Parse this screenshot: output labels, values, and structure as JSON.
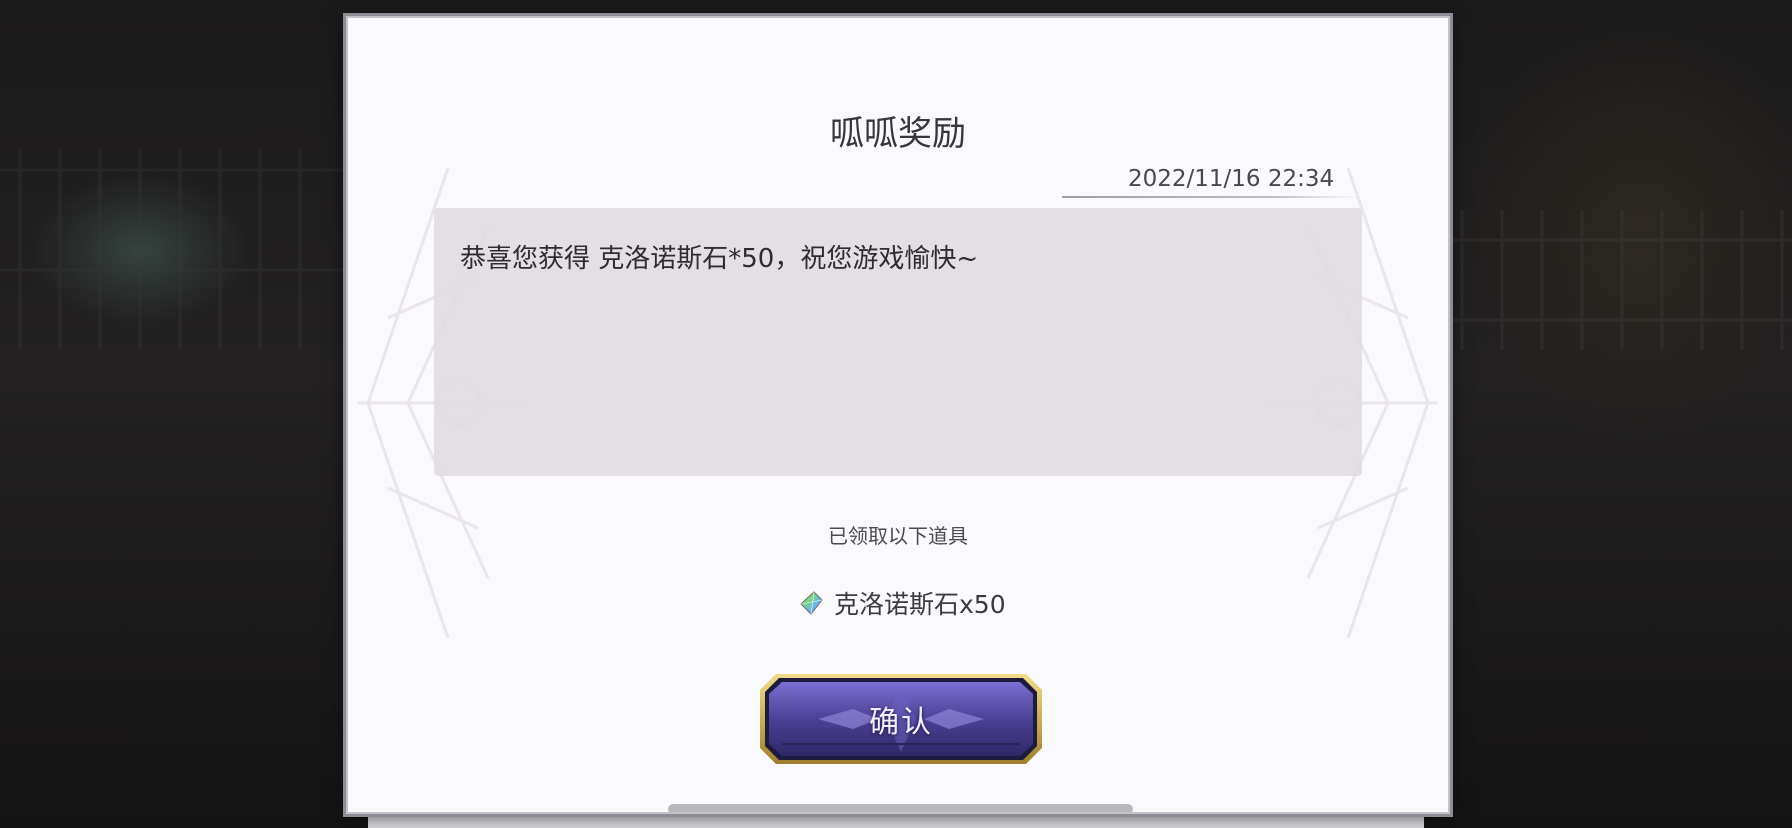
{
  "dialog": {
    "title": "呱呱奖励",
    "timestamp": "2022/11/16 22:34",
    "message": "恭喜您获得 克洛诺斯石*50，祝您游戏愉快~",
    "received_label": "已领取以下道具",
    "items": [
      {
        "icon": "chronos-stone-icon",
        "label": "克洛诺斯石x50"
      }
    ],
    "confirm_label": "确认"
  },
  "colors": {
    "dialog_bg": "#faf9fb",
    "message_bg": "#e0dbe0",
    "button_primary": "#5a4fa8",
    "button_border": "#c9a94a"
  }
}
